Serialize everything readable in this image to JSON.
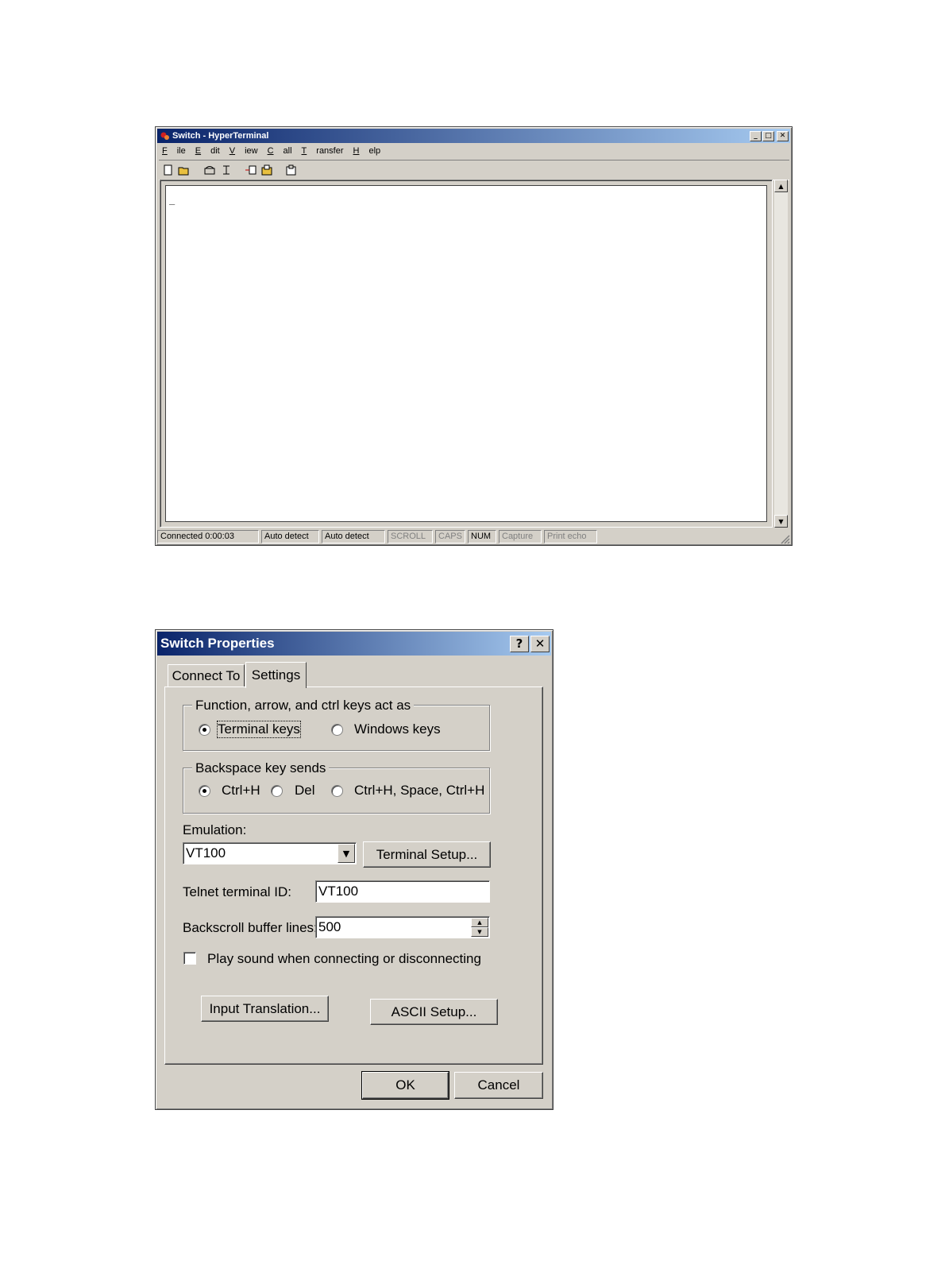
{
  "hyperterminal": {
    "title": "Switch - HyperTerminal",
    "menu": [
      "File",
      "Edit",
      "View",
      "Call",
      "Transfer",
      "Help"
    ],
    "toolbar_icons": [
      "new-icon",
      "open-icon",
      "call-icon",
      "disconnect-icon",
      "send-icon",
      "receive-icon",
      "properties-icon"
    ],
    "terminal_text": "_",
    "status": {
      "connected": "Connected 0:00:03",
      "auto_detect_1": "Auto detect",
      "auto_detect_2": "Auto detect",
      "scroll": "SCROLL",
      "caps": "CAPS",
      "num": "NUM",
      "capture": "Capture",
      "print_echo": "Print echo"
    }
  },
  "properties": {
    "title": "Switch Properties",
    "tabs": [
      "Connect To",
      "Settings"
    ],
    "active_tab": "Settings",
    "keys_group": {
      "label": "Function, arrow, and ctrl keys act as",
      "options": [
        "Terminal keys",
        "Windows keys"
      ],
      "selected": "Terminal keys"
    },
    "backspace_group": {
      "label": "Backspace key sends",
      "options": [
        "Ctrl+H",
        "Del",
        "Ctrl+H, Space, Ctrl+H"
      ],
      "selected": "Ctrl+H"
    },
    "emulation_label": "Emulation:",
    "emulation_value": "VT100",
    "terminal_setup_button": "Terminal Setup...",
    "telnet_label": "Telnet terminal ID:",
    "telnet_value": "VT100",
    "backscroll_label": "Backscroll buffer lines:",
    "backscroll_value": "500",
    "play_sound_label": "Play sound when connecting or disconnecting",
    "play_sound_checked": false,
    "input_translation_button": "Input Translation...",
    "ascii_setup_button": "ASCII Setup...",
    "ok_button": "OK",
    "cancel_button": "Cancel"
  }
}
